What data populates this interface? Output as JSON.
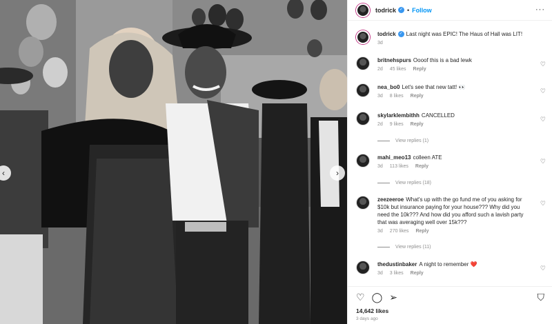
{
  "post": {
    "username": "todrick",
    "follow_label": "Follow",
    "more_icon": "more-icon"
  },
  "caption": {
    "username": "todrick",
    "text": "Last night was EPIC! The Haus of Hall was LIT!",
    "age": "3d"
  },
  "comments": [
    {
      "username": "britnehspurs",
      "text": "Oooof this is a bad lewk",
      "age": "2d",
      "likes": "45 likes",
      "reply": "Reply"
    },
    {
      "username": "nea_bo0",
      "text": "Let's see that new tatt! 👀",
      "age": "3d",
      "likes": "8 likes",
      "reply": "Reply"
    },
    {
      "username": "skylarklembithh",
      "text": "CANCELLED",
      "age": "2d",
      "likes": "9 likes",
      "reply": "Reply",
      "view_replies": "View replies (1)"
    },
    {
      "username": "mahi_meo13",
      "text": "colleen ATE",
      "age": "3d",
      "likes": "113 likes",
      "reply": "Reply",
      "view_replies": "View replies (18)"
    },
    {
      "username": "zeezeeroe",
      "text": "What's up with the go fund me of you asking for $10k but insurance paying for your house??? Why did you need the 10k??? And how did you afford such a lavish party that was averaging well over 15k???",
      "age": "3d",
      "likes": "270 likes",
      "reply": "Reply",
      "view_replies": "View replies (11)"
    },
    {
      "username": "thedustinbaker",
      "text": "A night to remember ❤️",
      "age": "3d",
      "likes": "3 likes",
      "reply": "Reply"
    }
  ],
  "footer": {
    "likes": "14,642 likes",
    "date": "3 days ago"
  },
  "colors": {
    "link": "#0095f6",
    "verified": "#3897f0",
    "meta": "#8e8e8e"
  }
}
